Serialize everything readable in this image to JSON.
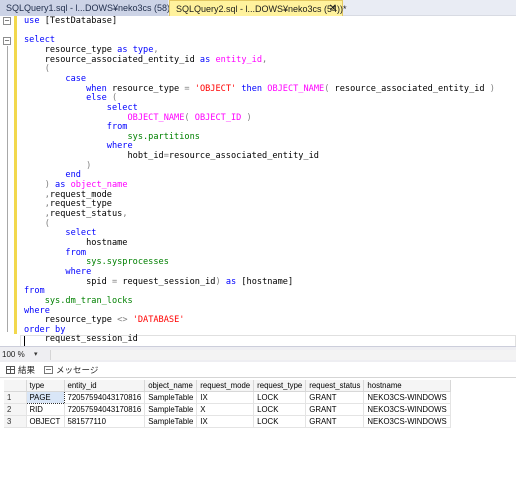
{
  "tabs": [
    {
      "label": "SQLQuery1.sql - l...DOWS¥neko3cs (58))*",
      "active": false
    },
    {
      "label": "SQLQuery2.sql - l...DOWS¥neko3cs (54))*",
      "active": true,
      "close": "✕"
    }
  ],
  "code": [
    [
      {
        "t": "use ",
        "c": "kw"
      },
      {
        "t": "[TestDatabase]",
        "c": ""
      }
    ],
    [],
    [
      {
        "t": "select",
        "c": "kw"
      }
    ],
    [
      {
        "t": "    resource_type ",
        "c": ""
      },
      {
        "t": "as",
        "c": "kw"
      },
      {
        "t": " ",
        "c": ""
      },
      {
        "t": "type",
        "c": "kw"
      },
      {
        "t": ",",
        "c": "op"
      }
    ],
    [
      {
        "t": "    resource_associated_entity_id ",
        "c": ""
      },
      {
        "t": "as",
        "c": "kw"
      },
      {
        "t": " ",
        "c": ""
      },
      {
        "t": "entity_id",
        "c": "fn"
      },
      {
        "t": ",",
        "c": "op"
      }
    ],
    [
      {
        "t": "    (",
        "c": "op"
      }
    ],
    [
      {
        "t": "        case",
        "c": "kw"
      }
    ],
    [
      {
        "t": "            when",
        "c": "kw"
      },
      {
        "t": " resource_type ",
        "c": ""
      },
      {
        "t": "=",
        "c": "op"
      },
      {
        "t": " ",
        "c": ""
      },
      {
        "t": "'OBJECT'",
        "c": "str"
      },
      {
        "t": " ",
        "c": ""
      },
      {
        "t": "then",
        "c": "kw"
      },
      {
        "t": " ",
        "c": ""
      },
      {
        "t": "OBJECT_NAME",
        "c": "fn"
      },
      {
        "t": "(",
        "c": "op"
      },
      {
        "t": " resource_associated_entity_id ",
        "c": ""
      },
      {
        "t": ")",
        "c": "op"
      }
    ],
    [
      {
        "t": "            else",
        "c": "kw"
      },
      {
        "t": " (",
        "c": "op"
      }
    ],
    [
      {
        "t": "                select",
        "c": "kw"
      }
    ],
    [
      {
        "t": "                    ",
        "c": ""
      },
      {
        "t": "OBJECT_NAME",
        "c": "fn"
      },
      {
        "t": "(",
        "c": "op"
      },
      {
        "t": " ",
        "c": ""
      },
      {
        "t": "OBJECT_ID",
        "c": "fn"
      },
      {
        "t": " )",
        "c": "op"
      }
    ],
    [
      {
        "t": "                from",
        "c": "kw"
      }
    ],
    [
      {
        "t": "                    ",
        "c": ""
      },
      {
        "t": "sys.partitions",
        "c": "sys"
      }
    ],
    [
      {
        "t": "                where",
        "c": "kw"
      }
    ],
    [
      {
        "t": "                    hobt_id",
        "c": ""
      },
      {
        "t": "=",
        "c": "op"
      },
      {
        "t": "resource_associated_entity_id",
        "c": ""
      }
    ],
    [
      {
        "t": "            )",
        "c": "op"
      }
    ],
    [
      {
        "t": "        end",
        "c": "kw"
      }
    ],
    [
      {
        "t": "    ) ",
        "c": "op"
      },
      {
        "t": "as",
        "c": "kw"
      },
      {
        "t": " ",
        "c": ""
      },
      {
        "t": "object_name",
        "c": "fn"
      }
    ],
    [
      {
        "t": "    ,",
        "c": "op"
      },
      {
        "t": "request_mode",
        "c": ""
      }
    ],
    [
      {
        "t": "    ,",
        "c": "op"
      },
      {
        "t": "request_type",
        "c": ""
      }
    ],
    [
      {
        "t": "    ,",
        "c": "op"
      },
      {
        "t": "request_status",
        "c": ""
      },
      {
        "t": ",",
        "c": "op"
      }
    ],
    [
      {
        "t": "    (",
        "c": "op"
      }
    ],
    [
      {
        "t": "        select",
        "c": "kw"
      }
    ],
    [
      {
        "t": "            hostname",
        "c": ""
      }
    ],
    [
      {
        "t": "        from",
        "c": "kw"
      }
    ],
    [
      {
        "t": "            ",
        "c": ""
      },
      {
        "t": "sys.sysprocesses",
        "c": "sys"
      }
    ],
    [
      {
        "t": "        where",
        "c": "kw"
      }
    ],
    [
      {
        "t": "            spid ",
        "c": ""
      },
      {
        "t": "=",
        "c": "op"
      },
      {
        "t": " request_session_id",
        "c": ""
      },
      {
        "t": ")",
        "c": "op"
      },
      {
        "t": " ",
        "c": ""
      },
      {
        "t": "as",
        "c": "kw"
      },
      {
        "t": " [hostname]",
        "c": ""
      }
    ],
    [
      {
        "t": "from",
        "c": "kw"
      }
    ],
    [
      {
        "t": "    ",
        "c": ""
      },
      {
        "t": "sys.dm_tran_locks",
        "c": "sys"
      }
    ],
    [
      {
        "t": "where",
        "c": "kw"
      }
    ],
    [
      {
        "t": "    resource_type ",
        "c": ""
      },
      {
        "t": "<>",
        "c": "op"
      },
      {
        "t": " ",
        "c": ""
      },
      {
        "t": "'DATABASE'",
        "c": "str"
      }
    ],
    [
      {
        "t": "order by",
        "c": "kw"
      }
    ],
    [
      {
        "t": "    request_session_id",
        "c": ""
      }
    ]
  ],
  "fold_markers": [
    "−",
    "−"
  ],
  "zoom": "100 %",
  "zoom_arrow": "▾",
  "results_tabs": [
    {
      "label": "結果",
      "icon": "grid-icon"
    },
    {
      "label": "メッセージ",
      "icon": "message-icon"
    }
  ],
  "results": {
    "columns": [
      "type",
      "entity_id",
      "object_name",
      "request_mode",
      "request_type",
      "request_status",
      "hostname"
    ],
    "rows": [
      {
        "n": "1",
        "cells": [
          "PAGE",
          "72057594043170816",
          "SampleTable",
          "IX",
          "LOCK",
          "GRANT",
          "NEKO3CS-WINDOWS"
        ]
      },
      {
        "n": "2",
        "cells": [
          "RID",
          "72057594043170816",
          "SampleTable",
          "X",
          "LOCK",
          "GRANT",
          "NEKO3CS-WINDOWS"
        ]
      },
      {
        "n": "3",
        "cells": [
          "OBJECT",
          "581577110",
          "SampleTable",
          "IX",
          "LOCK",
          "GRANT",
          "NEKO3CS-WINDOWS"
        ]
      }
    ]
  }
}
